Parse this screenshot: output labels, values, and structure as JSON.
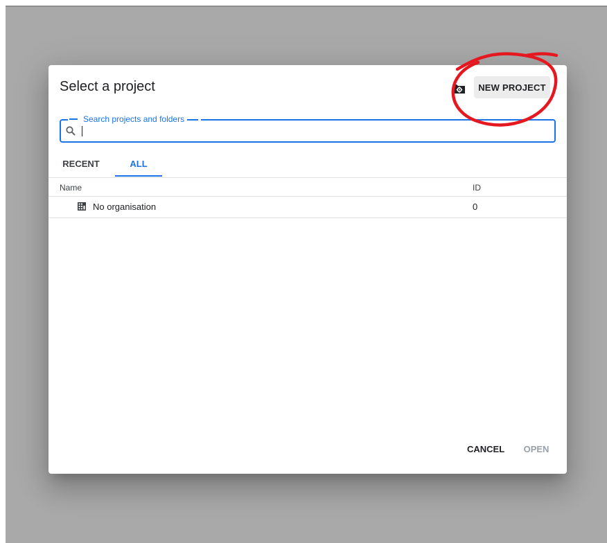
{
  "dialog": {
    "title": "Select a project",
    "new_project_label": "NEW PROJECT"
  },
  "search": {
    "label": "Search projects and folders",
    "value": "",
    "placeholder": ""
  },
  "tabs": [
    {
      "label": "RECENT",
      "selected": false
    },
    {
      "label": "ALL",
      "selected": true
    }
  ],
  "table": {
    "columns": {
      "name": "Name",
      "id": "ID"
    },
    "rows": [
      {
        "name": "No organisation",
        "id": "0",
        "icon": "building-icon"
      }
    ]
  },
  "footer": {
    "cancel_label": "CANCEL",
    "open_label": "OPEN"
  },
  "icons": {
    "folder_settings": "folder-settings-icon",
    "search": "search-icon",
    "building": "building-icon"
  },
  "colors": {
    "accent": "#1a73e8",
    "annotation": "#e5171f",
    "overlay": "#a9a9a9"
  }
}
